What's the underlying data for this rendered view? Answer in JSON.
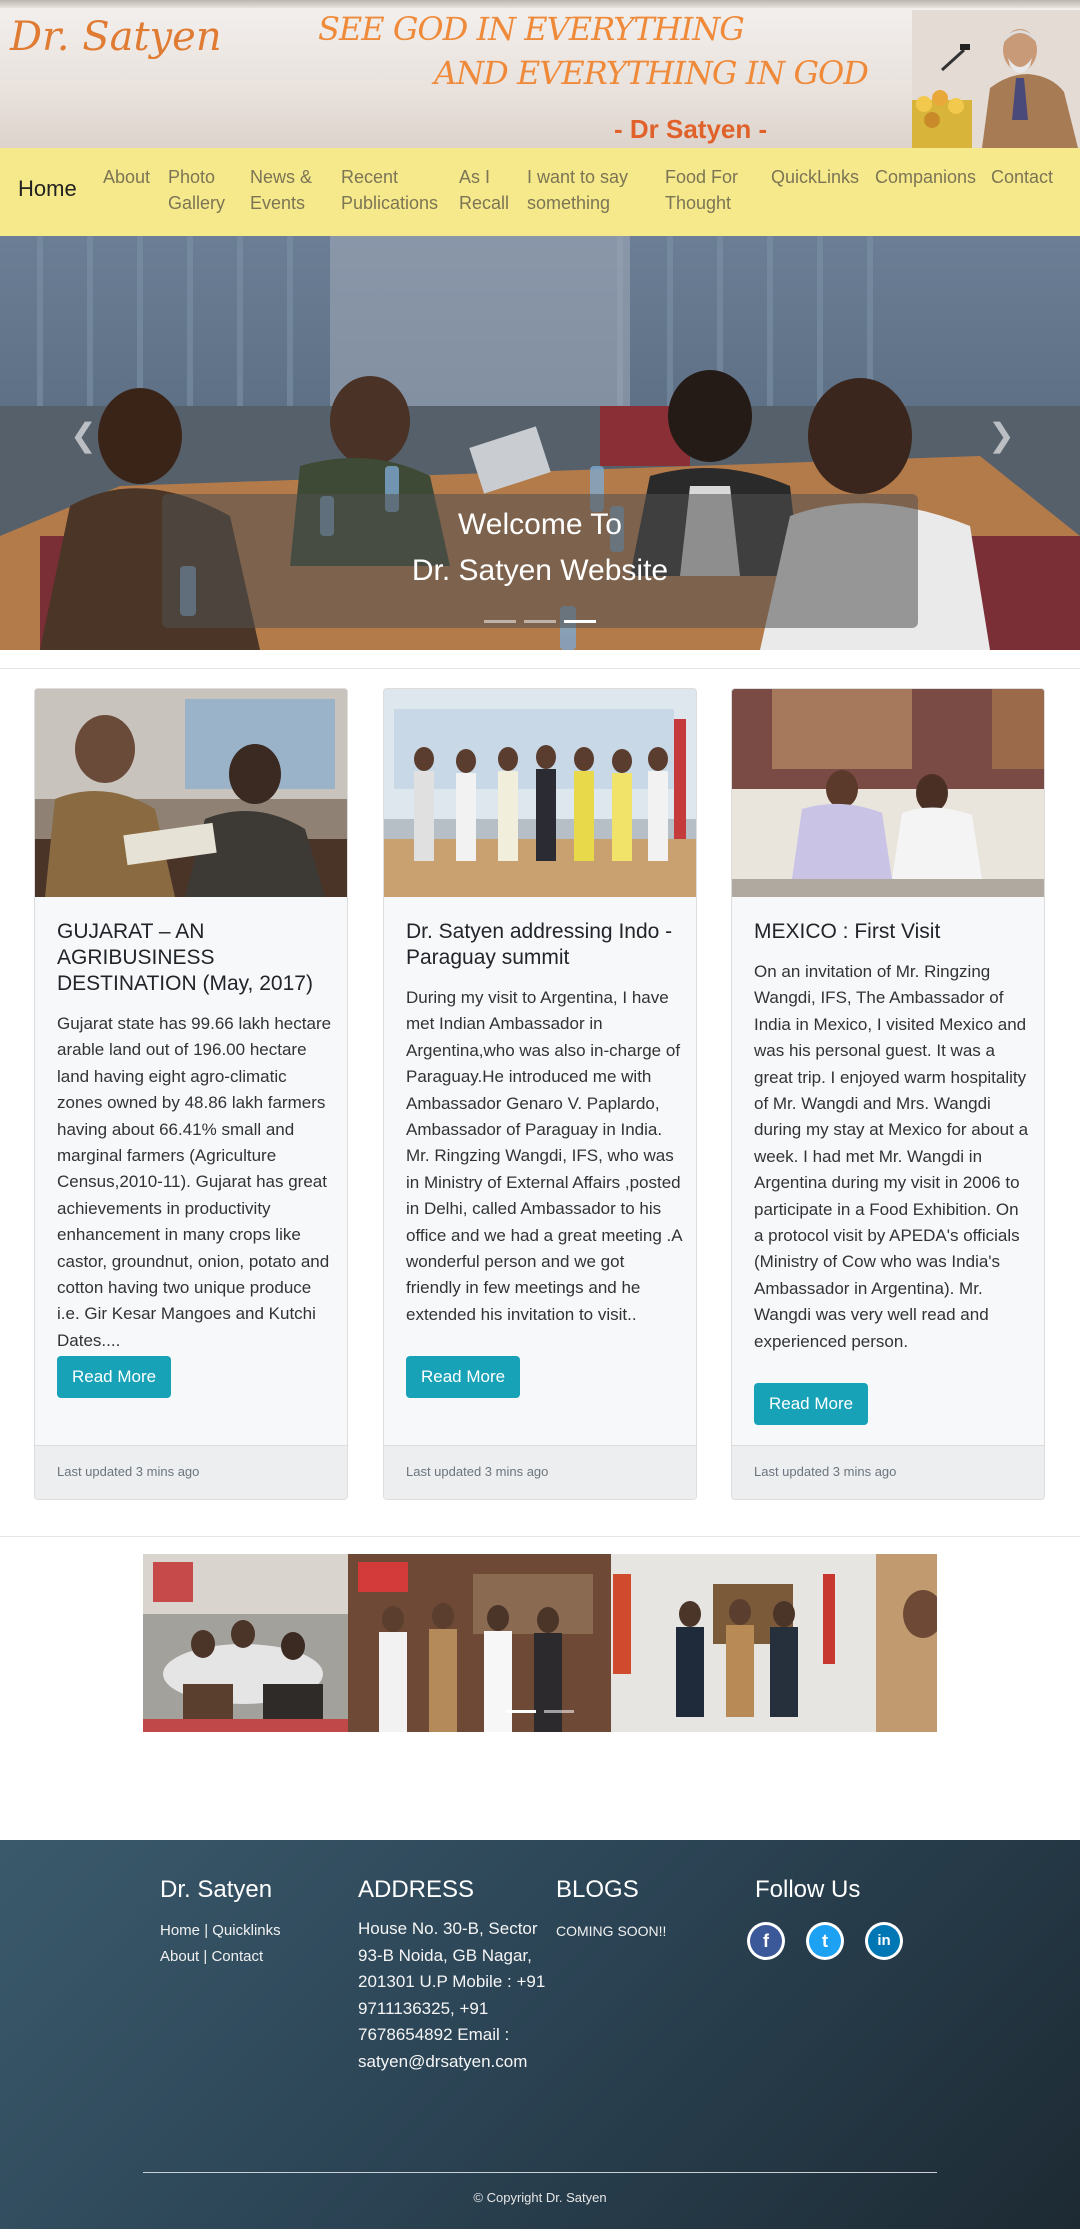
{
  "header": {
    "logo": "Dr. Satyen",
    "motto_line1": "SEE GOD IN EVERYTHING",
    "motto_line2": "AND EVERYTHING IN GOD",
    "motto_signature": "- Dr Satyen -"
  },
  "nav": {
    "brand": "Home",
    "items": [
      {
        "label": "About"
      },
      {
        "label": "Photo Gallery"
      },
      {
        "label": "News & Events"
      },
      {
        "label": "Recent Publications"
      },
      {
        "label": "As I Recall"
      },
      {
        "label": "I want to say something"
      },
      {
        "label": "Food For Thought"
      },
      {
        "label": "QuickLinks"
      },
      {
        "label": "Companions"
      },
      {
        "label": "Contact"
      }
    ]
  },
  "hero": {
    "caption_line1": "Welcome To",
    "caption_line2": "Dr. Satyen Website",
    "prev_icon": "chevron-left-icon",
    "next_icon": "chevron-right-icon",
    "slide_count": 3,
    "active_slide": 3
  },
  "cards": [
    {
      "title": "GUJARAT – AN AGRIBUSINESS DESTINATION (May, 2017)",
      "text": "Gujarat state has 99.66 lakh hectare arable land out of 196.00 hectare land having eight agro-climatic zones owned by 48.86 lakh farmers having about 66.41% small and marginal farmers (Agriculture Census,2010-11). Gujarat has great achievements in productivity enhancement in many crops like castor, groundnut, onion, potato and cotton having two unique produce i.e. Gir Kesar Mangoes and Kutchi Dates....",
      "button": "Read More",
      "footer": "Last updated 3 mins ago"
    },
    {
      "title": "Dr. Satyen addressing Indo - Paraguay summit",
      "text": "During my visit to Argentina, I have met Indian Ambassador in Argentina,who was also in-charge of Paraguay.He introduced me with Ambassador Genaro V. Paplardo, Ambassador of Paraguay in India. Mr. Ringzing Wangdi, IFS, who was in Ministry of External Affairs ,posted in Delhi, called Ambassador to his office and we had a great meeting .A wonderful person and we got friendly in few meetings and he extended his invitation to visit..",
      "button": "Read More",
      "footer": "Last updated 3 mins ago"
    },
    {
      "title": "MEXICO : First Visit",
      "text": "On an invitation of Mr. Ringzing Wangdi, IFS, The Ambassador of India in Mexico, I visited Mexico and was his personal guest. It was a great trip. I enjoyed warm hospitality of Mr. Wangdi and Mrs. Wangdi during my stay at Mexico for about a week. I had met Mr. Wangdi in Argentina during my visit in 2006 to participate in a Food Exhibition. On a protocol visit by APEDA's officials (Ministry of Cow who was India's Ambassador in Argentina). Mr. Wangdi was very well read and experienced person.",
      "button": "Read More",
      "footer": "Last updated 3 mins ago"
    }
  ],
  "footer": {
    "col1_title": "Dr. Satyen",
    "links_row1": [
      "Home",
      "Quicklinks"
    ],
    "links_row2": [
      "About",
      "Contact"
    ],
    "separator": "|",
    "col2_title": "ADDRESS",
    "address": "House No. 30-B, Sector 93-B Noida, GB Nagar, 201301 U.P Mobile : +91 9711136325, +91 7678654892 Email : satyen@drsatyen.com",
    "col3_title": "BLOGS",
    "blogs": "COMING SOON!!",
    "col4_title": "Follow Us",
    "social": [
      {
        "icon": "facebook-icon",
        "glyph": "f",
        "color": "#3b5998"
      },
      {
        "icon": "twitter-icon",
        "glyph": "t",
        "color": "#1da1f2"
      },
      {
        "icon": "linkedin-icon",
        "glyph": "in",
        "color": "#0077b5"
      }
    ],
    "copyright": "© Copyright Dr. Satyen"
  },
  "colors": {
    "navbar": "#f5e98b",
    "accent": "#17a2b8",
    "motto": "#ef8a3a"
  }
}
